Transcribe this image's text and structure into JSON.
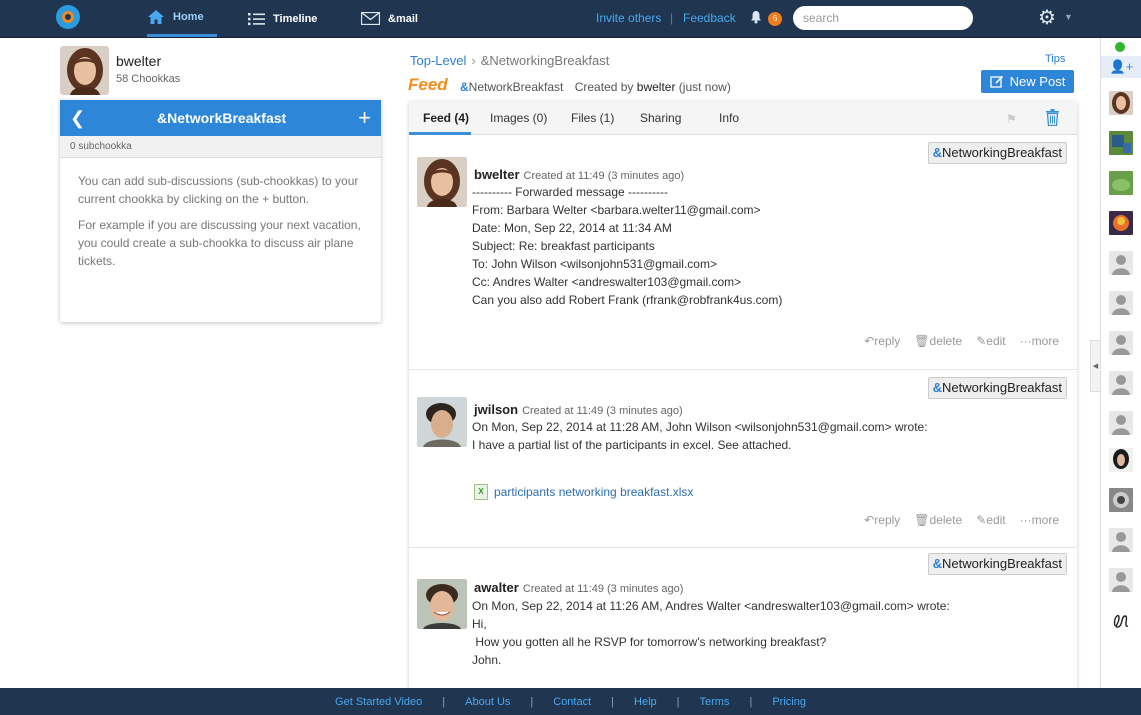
{
  "topbar": {
    "home": "Home",
    "timeline": "Timeline",
    "mail": "&mail",
    "invite": "Invite others",
    "feedback": "Feedback",
    "notifications": "6",
    "search_placeholder": "search"
  },
  "profile": {
    "name": "bwelter",
    "count": "58 Chookkas"
  },
  "subpanel": {
    "title": "&NetworkBreakfast",
    "count": "0 subchookka",
    "para1": "You can add sub-discussions (sub-chookkas) to your current chookka by clicking on the + button.",
    "para2": "For example if you are discussing your next vacation, you could create a sub-chookka to discuss air plane tickets."
  },
  "breadcrumb": {
    "root": "Top-Level",
    "current": "&NetworkingBreakfast"
  },
  "tips": "Tips",
  "feed_header": {
    "logo": "Feed",
    "topic_amp": "&",
    "topic": "NetworkBreakfast",
    "created_by": "Created by",
    "author": "bwelter",
    "when": "(just now)"
  },
  "new_post": "New Post",
  "tabs": [
    "Feed (4)",
    "Images (0)",
    "Files (1)",
    "Sharing",
    "Info"
  ],
  "chip": {
    "amp": "&",
    "label": "NetworkingBreakfast"
  },
  "actions": {
    "reply": "reply",
    "delete": "delete",
    "edit": "edit",
    "more": "more"
  },
  "posts": [
    {
      "author": "bwelter",
      "created": "Created at 11:49 (3 minutes ago)",
      "body": "---------- Forwarded message ----------\nFrom: Barbara Welter <barbara.welter11@gmail.com>\nDate: Mon, Sep 22, 2014 at 11:34 AM\nSubject: Re: breakfast participants\nTo: John Wilson <wilsonjohn531@gmail.com>\nCc: Andres Walter <andreswalter103@gmail.com>\nCan you also add Robert Frank (rfrank@robfrank4us.com)"
    },
    {
      "author": "jwilson",
      "created": "Created at 11:49 (3 minutes ago)",
      "body": "On Mon, Sep 22, 2014 at 11:28 AM, John Wilson <wilsonjohn531@gmail.com> wrote:\nI have a partial list of the participants in excel. See attached.",
      "attachment": "participants networking breakfast.xlsx"
    },
    {
      "author": "awalter",
      "created": "Created at 11:49 (3 minutes ago)",
      "body": "On Mon, Sep 22, 2014 at 11:26 AM, Andres Walter <andreswalter103@gmail.com> wrote:\nHi,\n How you gotten all he RSVP for tomorrow's networking breakfast?\nJohn."
    }
  ],
  "footer": [
    "Get Started Video",
    "About Us",
    "Contact",
    "Help",
    "Terms",
    "Pricing"
  ],
  "colors": {
    "topbar": "#1f3550",
    "accent": "#2d86d8",
    "feed_orange": "#f28f1c",
    "badge": "#f07c1c"
  }
}
